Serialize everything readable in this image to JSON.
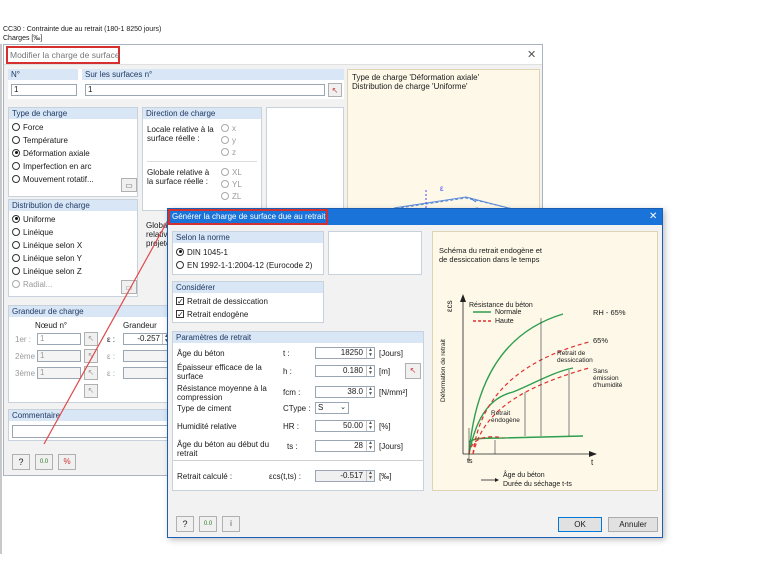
{
  "header": {
    "line1": "CC30 : Contrainte due au retrait (180-1 8250 jours)",
    "line2": "Charges [‰]"
  },
  "dialog1": {
    "title": "Modifier la charge de surface",
    "no_label": "N°",
    "no_value": "1",
    "surfaces_label": "Sur les surfaces n°",
    "surfaces_value": "1",
    "info_line1": "Type de charge 'Déformation axiale'",
    "info_line2": "Distribution de charge 'Uniforme'",
    "type_header": "Type de charge",
    "type_options": [
      "Force",
      "Température",
      "Déformation axiale",
      "Imperfection en arc",
      "Mouvement rotatif..."
    ],
    "direction_header": "Direction de charge",
    "locale_text": "Locale relative à la surface réelle :",
    "locale_axes": [
      "x",
      "y",
      "z"
    ],
    "globale_text": "Globale relative à la surface réelle :",
    "globale_axes": [
      "XL",
      "YL",
      "ZL"
    ],
    "globale2_text": "Globale relative projetée",
    "dist_header": "Distribution de charge",
    "dist_options": [
      "Uniforme",
      "Linéique",
      "Linéique selon X",
      "Linéique selon Y",
      "Linéique selon Z",
      "Radial..."
    ],
    "grandeur_header": "Grandeur de charge",
    "noeud_label": "Nœud n°",
    "grandeur_col": "Grandeur",
    "rows": [
      {
        "label": "1er :",
        "node": "1",
        "sym": "ε :",
        "value": "-0.257"
      },
      {
        "label": "2ème :",
        "node": "1",
        "sym": "ε :",
        "value": ""
      },
      {
        "label": "3ème :",
        "node": "1",
        "sym": "ε :",
        "value": ""
      }
    ],
    "comment_header": "Commentaire",
    "diagram_label": "ε"
  },
  "dialog2": {
    "title": "Générer la charge de surface due au retrait",
    "norme_header": "Selon la norme",
    "norme_options": [
      "DIN 1045-1",
      "EN 1992-1-1:2004-12 (Eurocode 2)"
    ],
    "considerer_header": "Considérer",
    "considerer_options": [
      "Retrait de dessiccation",
      "Retrait endogène"
    ],
    "params_header": "Paramètres de retrait",
    "params": [
      {
        "label": "Âge du béton",
        "sym": "t :",
        "value": "18250",
        "unit": "[Jours]"
      },
      {
        "label": "Épaisseur efficace de la surface",
        "sym": "h :",
        "value": "0.180",
        "unit": "[m]"
      },
      {
        "label": "Résistance moyenne à la compression",
        "sym": "fcm :",
        "value": "38.0",
        "unit": "[N/mm²]"
      },
      {
        "label": "Type de ciment",
        "sym": "CType :",
        "value": "S",
        "unit": ""
      },
      {
        "label": "Humidité relative",
        "sym": "HR :",
        "value": "50.00",
        "unit": "[%]"
      },
      {
        "label": "Âge du béton au début du retrait",
        "sym": "ts :",
        "value": "28",
        "unit": "[Jours]"
      }
    ],
    "calc_label": "Retrait calculé :",
    "calc_sym": "εcs(t,ts) :",
    "calc_value": "-0.517",
    "calc_unit": "[‰]",
    "ok_label": "OK",
    "cancel_label": "Annuler",
    "schema_title_1": "Schéma du retrait endogène et",
    "schema_title_2": "de dessiccation dans le temps",
    "schema": {
      "legend_title": "Résistance du béton",
      "legend_normale": "Normale",
      "legend_haute": "Haute",
      "rh65": "RH - 65%",
      "p65": "65%",
      "retrait_dess": "Retrait de dessiccation",
      "sans": "Sans émission d'humidité",
      "retrait_endo": "Retrait endogène",
      "ylabel": "Déformation de retrait",
      "eps": "εcs",
      "t": "t",
      "ts": "ts",
      "age": "Âge du béton",
      "duree": "Durée du séchage t-ts",
      "green": "#2e9e4f",
      "red": "#e03030"
    }
  }
}
